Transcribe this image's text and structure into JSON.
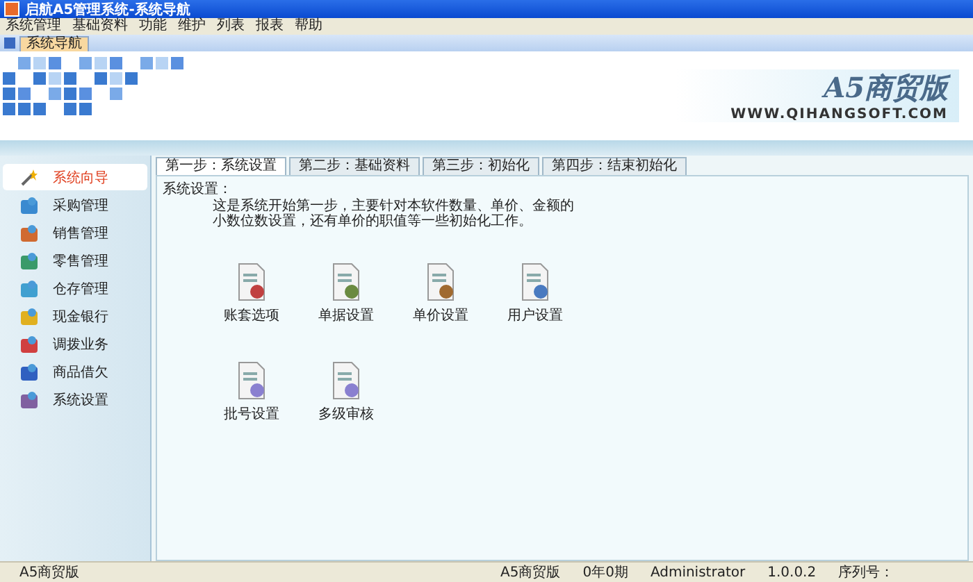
{
  "window": {
    "title": "启航A5管理系统-系统导航"
  },
  "menu": [
    "系统管理",
    "基础资料",
    "功能",
    "维护",
    "列表",
    "报表",
    "帮助"
  ],
  "doc_tabs": [
    {
      "label": "系统导航",
      "selected": true
    }
  ],
  "banner": {
    "logo": "A5商贸版",
    "url": "WWW.QIHANGSOFT.COM"
  },
  "sidebar": {
    "items": [
      {
        "label": "系统向导",
        "selected": true
      },
      {
        "label": "采购管理",
        "selected": false
      },
      {
        "label": "销售管理",
        "selected": false
      },
      {
        "label": "零售管理",
        "selected": false
      },
      {
        "label": "仓存管理",
        "selected": false
      },
      {
        "label": "现金银行",
        "selected": false
      },
      {
        "label": "调拨业务",
        "selected": false
      },
      {
        "label": "商品借欠",
        "selected": false
      },
      {
        "label": "系统设置",
        "selected": false
      }
    ]
  },
  "steps": [
    {
      "label": "第一步：系统设置",
      "selected": true
    },
    {
      "label": "第二步：基础资料",
      "selected": false
    },
    {
      "label": "第三步：初始化",
      "selected": false
    },
    {
      "label": "第四步：结束初始化",
      "selected": false
    }
  ],
  "panel": {
    "heading": "系统设置：",
    "description": "这是系统开始第一步，主要针对本软件数量、单价、金额的小数位数设置，还有单价的职值等一些初始化工作。",
    "shortcuts": [
      {
        "label": "账套选项"
      },
      {
        "label": "单据设置"
      },
      {
        "label": "单价设置"
      },
      {
        "label": "用户设置"
      },
      {
        "label": "批号设置"
      },
      {
        "label": "多级审核"
      }
    ]
  },
  "status_bar": [
    "A5商贸版",
    "A5商贸版",
    "0年0期",
    "Administrator",
    "1.0.0.2",
    "序列号："
  ]
}
